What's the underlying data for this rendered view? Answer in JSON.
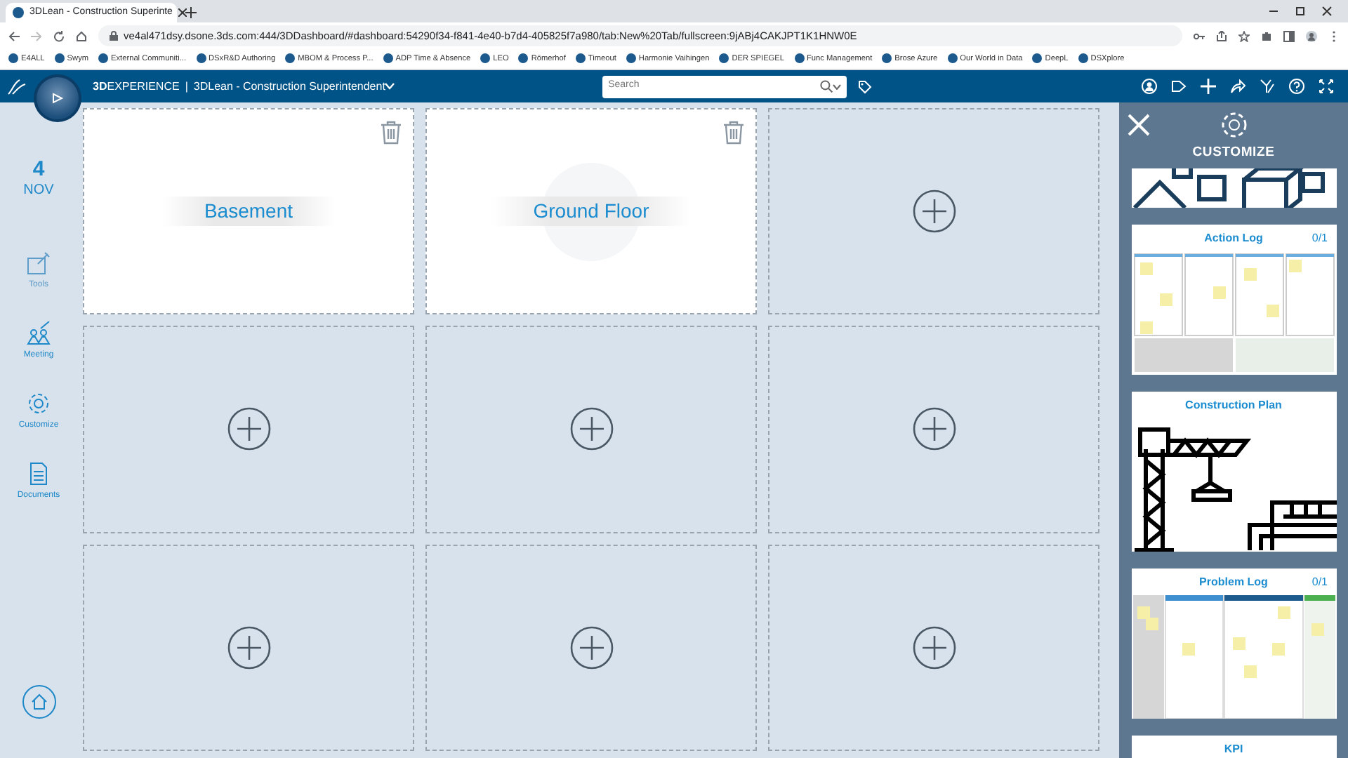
{
  "browser": {
    "tab_title": "3DLean - Construction Superinte",
    "url": "ve4al471dsy.dsone.3ds.com:444/3DDashboard/#dashboard:54290f34-f841-4e40-b7d4-405825f7a980/tab:New%20Tab/fullscreen:9jABj4CAKJPT1K1HNW0E",
    "bookmarks": [
      "E4ALL",
      "Swym",
      "External Communiti...",
      "DSxR&D Authoring",
      "MBOM & Process P...",
      "ADP Time & Absence",
      "LEO",
      "Römerhof",
      "Timeout",
      "Harmonie Vaihingen",
      "DER SPIEGEL",
      "Func Management",
      "Brose Azure",
      "Our World in Data",
      "DeepL",
      "DSXplore"
    ]
  },
  "app_bar": {
    "brand_bold": "3D",
    "brand": "EXPERIENCE",
    "separator": "|",
    "title": "3DLean - Construction Superintendent",
    "search": {
      "placeholder": "Search"
    }
  },
  "sidebar": {
    "day": "4",
    "month": "NOV",
    "items": [
      {
        "kind": "tools",
        "label": "Tools",
        "disabled": true
      },
      {
        "kind": "meeting",
        "label": "Meeting",
        "disabled": false
      },
      {
        "kind": "customize",
        "label": "Customize",
        "disabled": false
      },
      {
        "kind": "documents",
        "label": "Documents",
        "disabled": false
      }
    ]
  },
  "tiles": [
    {
      "kind": "area",
      "title": "Basement",
      "watermark": false
    },
    {
      "kind": "area",
      "title": "Ground Floor",
      "watermark": true
    },
    {
      "kind": "empty"
    },
    {
      "kind": "empty"
    },
    {
      "kind": "empty"
    },
    {
      "kind": "empty"
    },
    {
      "kind": "empty"
    },
    {
      "kind": "empty"
    },
    {
      "kind": "empty"
    }
  ],
  "customize": {
    "title": "CUSTOMIZE",
    "templates": [
      {
        "kind": "cubes"
      },
      {
        "kind": "kanban",
        "title": "Action Log",
        "count": "0/1"
      },
      {
        "kind": "crane",
        "title": "Construction Plan"
      },
      {
        "kind": "problem",
        "title": "Problem Log",
        "count": "0/1"
      },
      {
        "kind": "cut",
        "title": "KPI"
      }
    ]
  }
}
